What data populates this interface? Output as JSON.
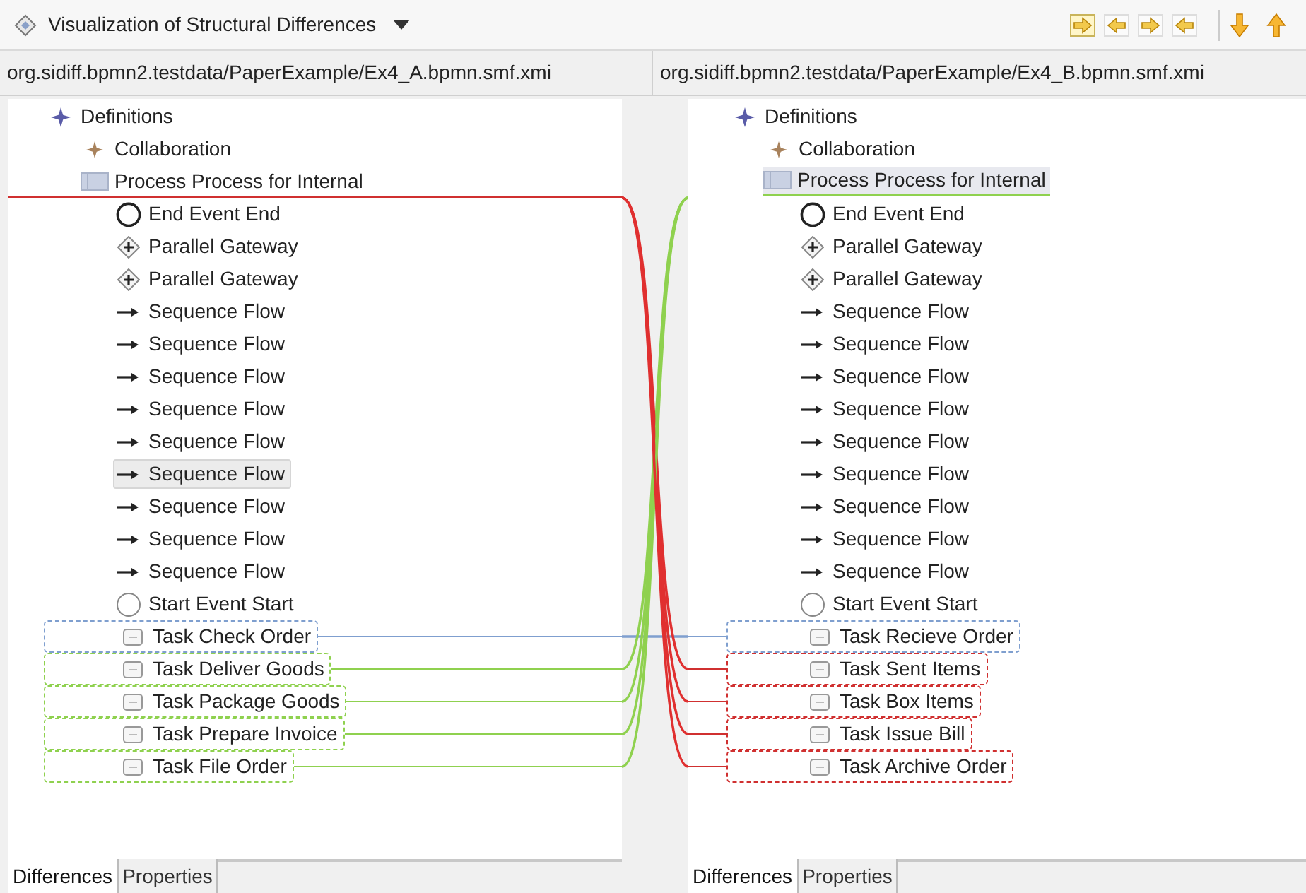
{
  "view": {
    "title": "Visualization of Structural Differences"
  },
  "toolbar": {
    "buttons": [
      {
        "kind": "nav"
      },
      {
        "kind": "nav"
      },
      {
        "kind": "nav"
      },
      {
        "kind": "nav"
      },
      {
        "kind": "down"
      },
      {
        "kind": "up"
      }
    ]
  },
  "panels": [
    {
      "path": "org.sidiff.bpmn2.testdata/PaperExample/Ex4_A.bpmn.smf.xmi",
      "tree": [
        {
          "label": "Definitions",
          "kind": "definitions",
          "selected": false,
          "children": [
            {
              "label": "Collaboration",
              "kind": "collaboration",
              "selected": false
            },
            {
              "label": "Process Process for Internal",
              "kind": "process",
              "selected": false,
              "children": [
                {
                  "label": "End Event End",
                  "kind": "end-event",
                  "selected": false
                },
                {
                  "label": "Parallel Gateway",
                  "kind": "gateway",
                  "selected": false
                },
                {
                  "label": "Parallel Gateway",
                  "kind": "gateway",
                  "selected": false
                },
                {
                  "label": "Sequence Flow",
                  "kind": "flow",
                  "selected": false
                },
                {
                  "label": "Sequence Flow",
                  "kind": "flow",
                  "selected": false
                },
                {
                  "label": "Sequence Flow",
                  "kind": "flow",
                  "selected": false
                },
                {
                  "label": "Sequence Flow",
                  "kind": "flow",
                  "selected": false
                },
                {
                  "label": "Sequence Flow",
                  "kind": "flow",
                  "selected": false
                },
                {
                  "label": "Sequence Flow",
                  "kind": "flow",
                  "selected": true
                },
                {
                  "label": "Sequence Flow",
                  "kind": "flow",
                  "selected": false
                },
                {
                  "label": "Sequence Flow",
                  "kind": "flow",
                  "selected": false
                },
                {
                  "label": "Sequence Flow",
                  "kind": "flow",
                  "selected": false
                },
                {
                  "label": "Start Event Start",
                  "kind": "start-event",
                  "selected": false
                },
                {
                  "label": "Task Check Order",
                  "kind": "task",
                  "selected": false,
                  "color": "#7f9fcf"
                },
                {
                  "label": "Task Deliver Goods",
                  "kind": "task",
                  "selected": false,
                  "color": "#8fd14f"
                },
                {
                  "label": "Task Package Goods",
                  "kind": "task",
                  "selected": false,
                  "color": "#8fd14f"
                },
                {
                  "label": "Task Prepare Invoice",
                  "kind": "task",
                  "selected": false,
                  "color": "#8fd14f"
                },
                {
                  "label": "Task File Order",
                  "kind": "task",
                  "selected": false,
                  "color": "#8fd14f"
                }
              ]
            }
          ]
        }
      ],
      "tabs": [
        {
          "label": "Differences",
          "selected": true
        },
        {
          "label": "Properties",
          "selected": false
        }
      ]
    },
    {
      "path": "org.sidiff.bpmn2.testdata/PaperExample/Ex4_B.bpmn.smf.xmi",
      "tree": [
        {
          "label": "Definitions",
          "kind": "definitions",
          "selected": false,
          "children": [
            {
              "label": "Collaboration",
              "kind": "collaboration",
              "selected": false
            },
            {
              "label": "Process Process for Internal",
              "kind": "process",
              "selected": true,
              "children": [
                {
                  "label": "End Event End",
                  "kind": "end-event",
                  "selected": false
                },
                {
                  "label": "Parallel Gateway",
                  "kind": "gateway",
                  "selected": false
                },
                {
                  "label": "Parallel Gateway",
                  "kind": "gateway",
                  "selected": false
                },
                {
                  "label": "Sequence Flow",
                  "kind": "flow",
                  "selected": false
                },
                {
                  "label": "Sequence Flow",
                  "kind": "flow",
                  "selected": false
                },
                {
                  "label": "Sequence Flow",
                  "kind": "flow",
                  "selected": false
                },
                {
                  "label": "Sequence Flow",
                  "kind": "flow",
                  "selected": false
                },
                {
                  "label": "Sequence Flow",
                  "kind": "flow",
                  "selected": false
                },
                {
                  "label": "Sequence Flow",
                  "kind": "flow",
                  "selected": false
                },
                {
                  "label": "Sequence Flow",
                  "kind": "flow",
                  "selected": false
                },
                {
                  "label": "Sequence Flow",
                  "kind": "flow",
                  "selected": false
                },
                {
                  "label": "Sequence Flow",
                  "kind": "flow",
                  "selected": false
                },
                {
                  "label": "Start Event Start",
                  "kind": "start-event",
                  "selected": false
                },
                {
                  "label": "Task Recieve Order",
                  "kind": "task",
                  "selected": false,
                  "color": "#7f9fcf"
                },
                {
                  "label": "Task Sent Items",
                  "kind": "task",
                  "selected": false,
                  "color": "#d03030"
                },
                {
                  "label": "Task Box Items",
                  "kind": "task",
                  "selected": false,
                  "color": "#d03030"
                },
                {
                  "label": "Task Issue Bill",
                  "kind": "task",
                  "selected": false,
                  "color": "#d03030"
                },
                {
                  "label": "Task Archive Order",
                  "kind": "task",
                  "selected": false,
                  "color": "#d03030"
                }
              ]
            }
          ]
        }
      ],
      "tabs": [
        {
          "label": "Differences",
          "selected": true
        },
        {
          "label": "Properties",
          "selected": false
        }
      ]
    }
  ]
}
